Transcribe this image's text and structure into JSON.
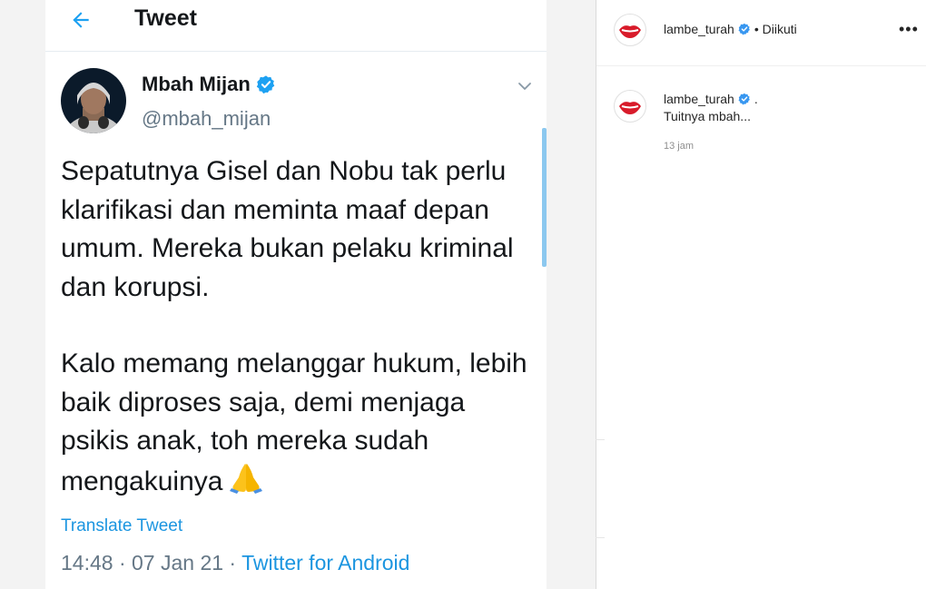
{
  "tweet": {
    "header_title": "Tweet",
    "author_name": "Mbah Mijan",
    "author_handle": "@mbah_mijan",
    "paragraph1": "Sepatutnya Gisel dan Nobu tak perlu klarifikasi dan meminta maaf depan umum. Mereka bukan pelaku kriminal dan korupsi.",
    "paragraph2": "Kalo memang melanggar hukum, lebih baik diproses saja, demi menjaga psikis anak, toh mereka sudah mengakuinya",
    "translate_label": "Translate Tweet",
    "timestamp": "14:48 · 07 Jan 21 · ",
    "source": "Twitter for Android"
  },
  "instagram": {
    "header_username": "lambe_turah",
    "header_follow_status": "• Diikuti",
    "comment_username": "lambe_turah",
    "comment_suffix": ".",
    "caption": "Tuitnya mbah...",
    "time_ago": "13 jam",
    "more_label": "•••"
  },
  "colors": {
    "twitter_blue": "#1b95e0",
    "verified_blue": "#1da1f2",
    "text_dark": "#14171a",
    "text_gray": "#657786"
  },
  "icons": [
    "back-arrow-icon",
    "verified-badge-icon",
    "chevron-down-icon",
    "praying-hands-emoji",
    "more-options-icon",
    "lips-logo-avatar"
  ]
}
